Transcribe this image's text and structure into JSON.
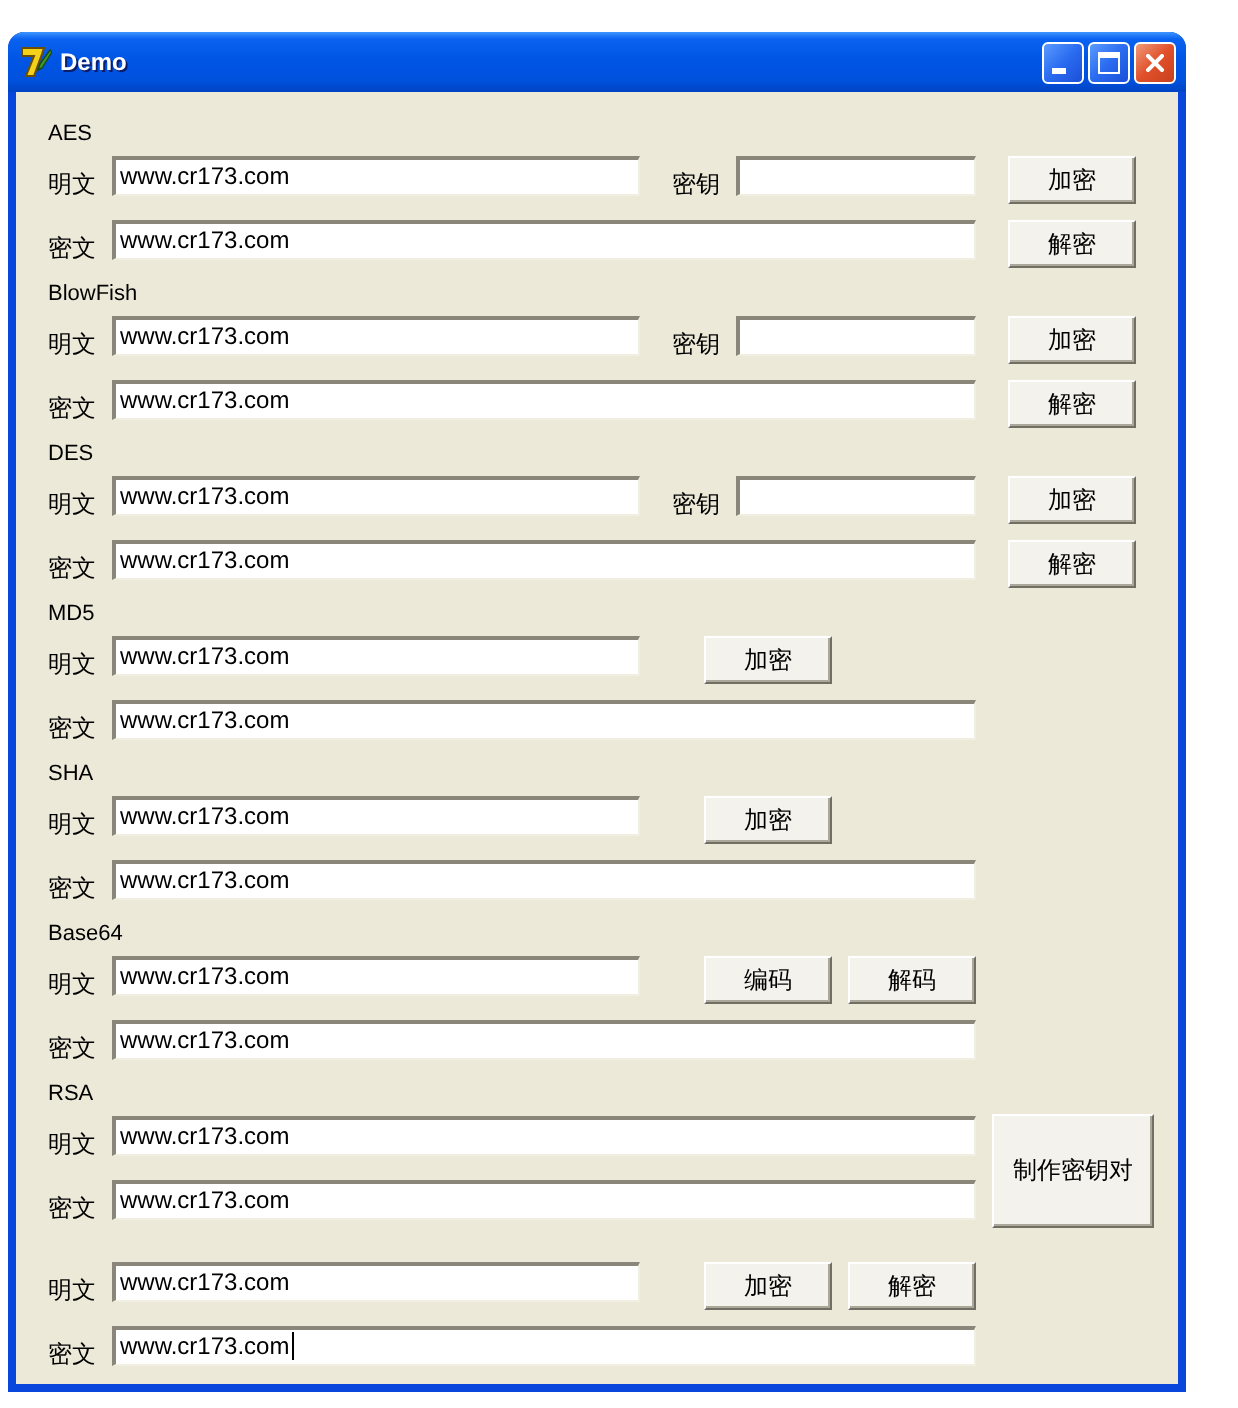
{
  "window": {
    "title": "Demo"
  },
  "sections": [
    {
      "title": "AES",
      "rows": [
        {
          "kind": "keyed",
          "label": "明文",
          "value": "www.cr173.com",
          "focused": false,
          "key": {
            "label": "密钥"
          },
          "buttons": [
            "加密"
          ]
        },
        {
          "kind": "wide",
          "label": "密文",
          "value": "www.cr173.com",
          "focused": false,
          "buttons": [
            "解密"
          ]
        }
      ]
    },
    {
      "title": "BlowFish",
      "rows": [
        {
          "kind": "keyed",
          "label": "明文",
          "value": "www.cr173.com",
          "focused": false,
          "key": {
            "label": "密钥"
          },
          "buttons": [
            "加密"
          ]
        },
        {
          "kind": "wide",
          "label": "密文",
          "value": "www.cr173.com",
          "focused": false,
          "buttons": [
            "解密"
          ]
        }
      ]
    },
    {
      "title": "DES",
      "rows": [
        {
          "kind": "keyed",
          "label": "明文",
          "value": "www.cr173.com",
          "focused": false,
          "key": {
            "label": "密钥"
          },
          "buttons": [
            "加密"
          ]
        },
        {
          "kind": "wide",
          "label": "密文",
          "value": "www.cr173.com",
          "focused": false,
          "buttons": [
            "解密"
          ]
        }
      ]
    },
    {
      "title": "MD5",
      "rows": [
        {
          "kind": "inline",
          "label": "明文",
          "value": "www.cr173.com",
          "focused": false,
          "buttons": [
            "加密"
          ]
        },
        {
          "kind": "wide",
          "label": "密文",
          "value": "www.cr173.com",
          "focused": false
        }
      ]
    },
    {
      "title": "SHA",
      "rows": [
        {
          "kind": "inline",
          "label": "明文",
          "value": "www.cr173.com",
          "focused": false,
          "buttons": [
            "加密"
          ]
        },
        {
          "kind": "wide",
          "label": "密文",
          "value": "www.cr173.com",
          "focused": false
        }
      ]
    },
    {
      "title": "Base64",
      "rows": [
        {
          "kind": "inline",
          "label": "明文",
          "value": "www.cr173.com",
          "focused": false,
          "buttons": [
            "编码",
            "解码"
          ]
        },
        {
          "kind": "wide",
          "label": "密文",
          "value": "www.cr173.com",
          "focused": false
        }
      ]
    },
    {
      "title": "RSA",
      "side_button": "制作密钥对",
      "rows": [
        {
          "kind": "wide",
          "label": "明文",
          "value": "www.cr173.com",
          "focused": false
        },
        {
          "kind": "wide",
          "label": "密文",
          "value": "www.cr173.com",
          "focused": false
        }
      ]
    },
    {
      "rows": [
        {
          "kind": "inline",
          "label": "明文",
          "value": "www.cr173.com",
          "focused": false,
          "buttons": [
            "加密",
            "解密"
          ]
        },
        {
          "kind": "wide",
          "label": "密文",
          "value": "www.cr173.com",
          "focused": true
        }
      ]
    }
  ]
}
